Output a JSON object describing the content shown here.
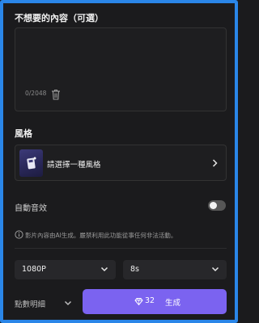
{
  "negative_prompt": {
    "title": "不想要的內容（可選）",
    "value": "",
    "char_count": "0/2048"
  },
  "style": {
    "label": "風格",
    "select_text": "請選擇一種風格"
  },
  "auto_audio": {
    "label": "自動音效",
    "enabled": false
  },
  "notice": "影片內容由AI生成。嚴禁利用此功能從事任何非法活動。",
  "resolution": {
    "value": "1080P"
  },
  "duration": {
    "value": "8s"
  },
  "footer": {
    "details_label": "點數明細",
    "generate_cost": "32",
    "generate_label": "生成"
  },
  "colors": {
    "accent": "#7b63f0",
    "frame": "#2a86e8",
    "background": "#1b1b1d"
  },
  "icons": {
    "trash": "trash-icon",
    "style_thumb": "style-thumbnail",
    "chevron_right": "chevron-right-icon",
    "info": "info-icon",
    "chevron_down": "chevron-down-icon",
    "gem": "gem-icon"
  }
}
